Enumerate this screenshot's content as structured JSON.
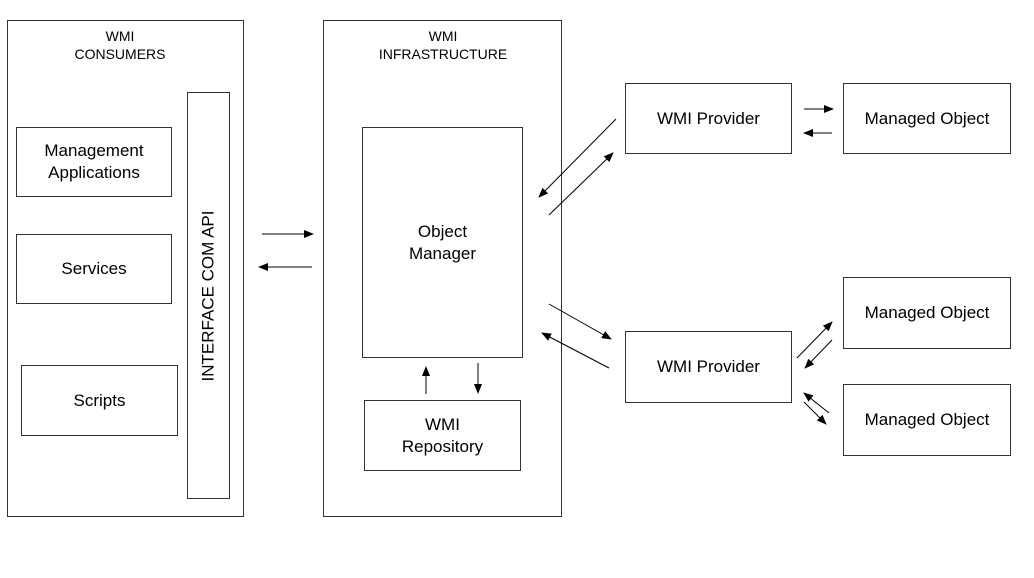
{
  "consumers": {
    "title": "WMI\nCONSUMERS",
    "items": [
      "Management\nApplications",
      "Services",
      "Scripts"
    ],
    "interface": "INTERFACE COM API"
  },
  "infrastructure": {
    "title": "WMI\nINFRASTRUCTURE",
    "object_manager": "Object\nManager",
    "repository": "WMI\nRepository"
  },
  "providers": [
    "WMI Provider",
    "WMI Provider"
  ],
  "managed_objects": [
    "Managed Object",
    "Managed Object",
    "Managed Object"
  ]
}
